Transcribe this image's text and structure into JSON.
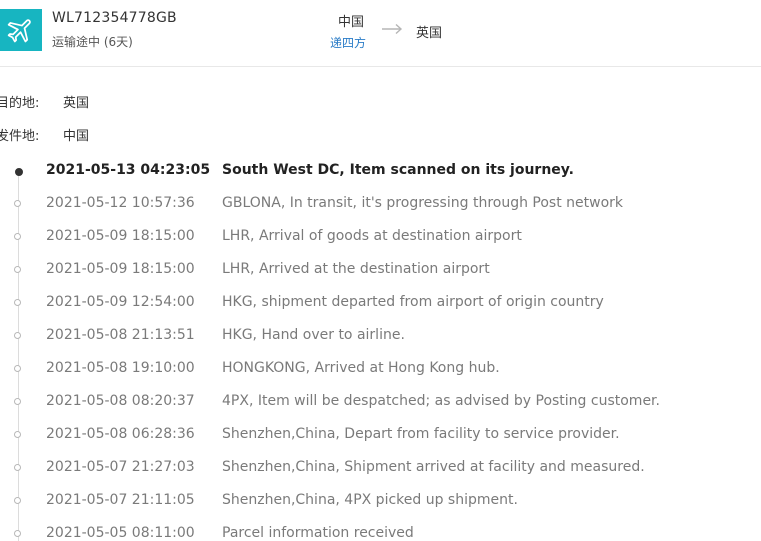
{
  "header": {
    "tracking_number": "WL712354778GB",
    "status": "运输途中 (6天)",
    "origin_country": "中国",
    "carrier": "递四方",
    "destination_country": "英国",
    "icon": "airplane-icon",
    "accent_color": "#17b5c1"
  },
  "info": {
    "destination_label": "目的地:",
    "destination_value": "英国",
    "origin_label": "发件地:",
    "origin_value": "中国"
  },
  "events": [
    {
      "time": "2021-05-13 04:23:05",
      "desc": "South West DC, Item scanned on its journey."
    },
    {
      "time": "2021-05-12 10:57:36",
      "desc": "GBLONA, In transit, it's progressing through Post network"
    },
    {
      "time": "2021-05-09 18:15:00",
      "desc": "LHR, Arrival of goods at destination airport"
    },
    {
      "time": "2021-05-09 18:15:00",
      "desc": "LHR, Arrived at the destination airport"
    },
    {
      "time": "2021-05-09 12:54:00",
      "desc": "HKG, shipment departed from airport of origin country"
    },
    {
      "time": "2021-05-08 21:13:51",
      "desc": "HKG, Hand over to airline."
    },
    {
      "time": "2021-05-08 19:10:00",
      "desc": "HONGKONG, Arrived at Hong Kong hub."
    },
    {
      "time": "2021-05-08 08:20:37",
      "desc": "4PX, Item will be despatched; as advised by Posting customer."
    },
    {
      "time": "2021-05-08 06:28:36",
      "desc": "Shenzhen,China, Depart from facility to service provider."
    },
    {
      "time": "2021-05-07 21:27:03",
      "desc": "Shenzhen,China, Shipment arrived at facility and measured."
    },
    {
      "time": "2021-05-07 21:11:05",
      "desc": "Shenzhen,China, 4PX picked up shipment."
    },
    {
      "time": "2021-05-05 08:11:00",
      "desc": "Parcel information received"
    }
  ]
}
